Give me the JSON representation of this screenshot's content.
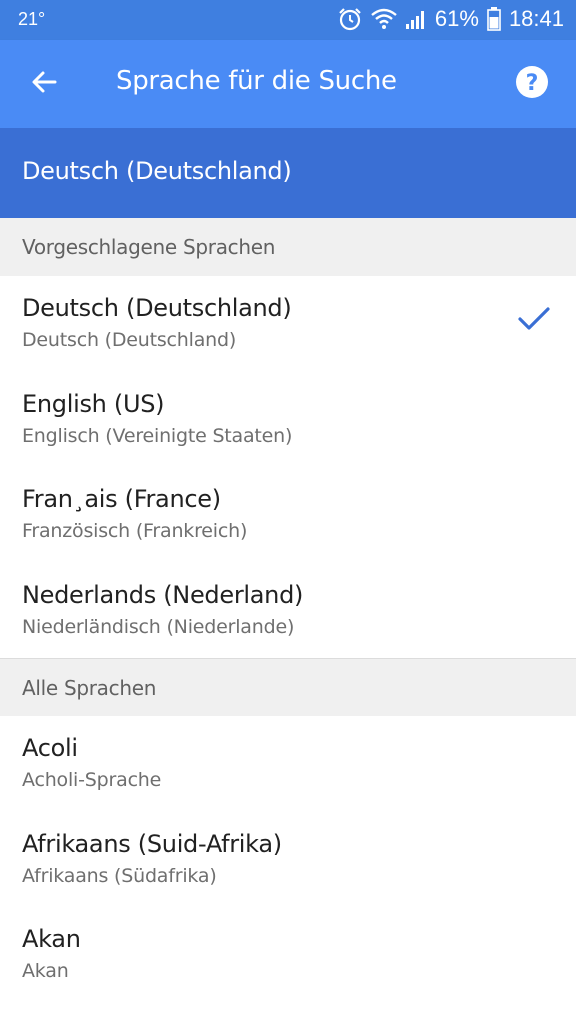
{
  "status": {
    "temperature": "21°",
    "battery_percent": "61%",
    "time": "18:41",
    "icons": [
      "alarm-icon",
      "wifi-icon",
      "signal-icon",
      "battery-icon"
    ]
  },
  "app_bar": {
    "title": "Sprache für die Suche",
    "back_icon": "arrow-left-icon",
    "help_icon": "help-circle-icon"
  },
  "selected_language": "Deutsch (Deutschland)",
  "sections": {
    "suggested": {
      "header": "Vorgeschlagene Sprachen",
      "items": [
        {
          "title": "Deutsch (Deutschland)",
          "subtitle": "Deutsch (Deutschland)",
          "selected": true
        },
        {
          "title": "English (US)",
          "subtitle": "Englisch (Vereinigte Staaten)",
          "selected": false
        },
        {
          "title": "Fran¸ais (France)",
          "subtitle": "Französisch (Frankreich)",
          "selected": false
        },
        {
          "title": "Nederlands (Nederland)",
          "subtitle": "Niederländisch (Niederlande)",
          "selected": false
        }
      ]
    },
    "all": {
      "header": "Alle Sprachen",
      "items": [
        {
          "title": "Acoli",
          "subtitle": "Acholi-Sprache"
        },
        {
          "title": "Afrikaans (Suid-Afrika)",
          "subtitle": "Afrikaans (Südafrika)"
        },
        {
          "title": "Akan",
          "subtitle": "Akan"
        }
      ]
    }
  },
  "colors": {
    "status_bar": "#3f7fe0",
    "app_bar": "#4a8bf5",
    "selected_bar": "#3a6fd4",
    "check": "#3a6fd4"
  }
}
